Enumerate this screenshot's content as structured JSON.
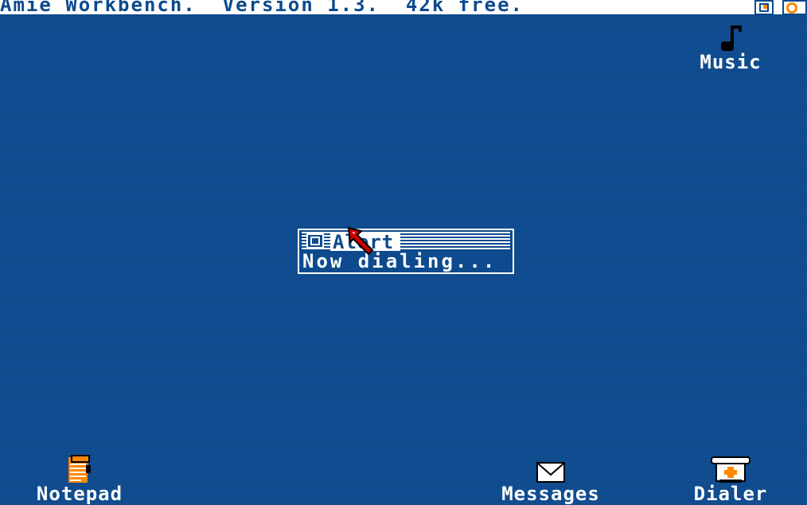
{
  "screen": {
    "title": "Amie Workbench.  Version 1.3.  42k free.",
    "background_color": "#0d4a8e",
    "accent_color": "#ff8800",
    "gadgets": [
      "depth-back-icon",
      "depth-front-icon"
    ]
  },
  "desktop_icons": [
    {
      "label": "Music",
      "icon": "music-note-icon"
    },
    {
      "label": "Notepad",
      "icon": "notepad-icon"
    },
    {
      "label": "Messages",
      "icon": "envelope-icon"
    },
    {
      "label": "Dialer",
      "icon": "telephone-icon"
    }
  ],
  "alert_window": {
    "title": "Alert",
    "message": "Now dialing..."
  },
  "pointer": {
    "icon": "mouse-pointer-icon",
    "color": "#cc0000"
  }
}
